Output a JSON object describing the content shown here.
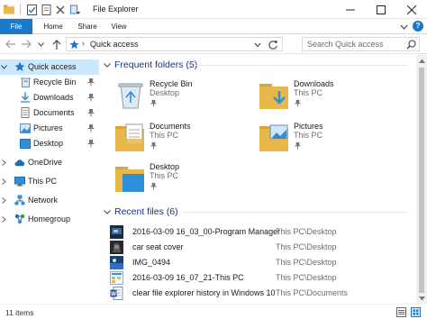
{
  "window": {
    "title": "File Explorer"
  },
  "ribbon": {
    "tabs": [
      "File",
      "Home",
      "Share",
      "View"
    ]
  },
  "address": {
    "current": "Quick access",
    "search_placeholder": "Search Quick access"
  },
  "nav": {
    "items": [
      {
        "label": "Quick access",
        "icon": "star-icon",
        "selected": true,
        "pinned": false
      },
      {
        "label": "Recycle Bin",
        "icon": "recycle-bin-icon",
        "pinned": true
      },
      {
        "label": "Downloads",
        "icon": "downloads-icon",
        "pinned": true
      },
      {
        "label": "Documents",
        "icon": "documents-icon",
        "pinned": true
      },
      {
        "label": "Pictures",
        "icon": "pictures-icon",
        "pinned": true
      },
      {
        "label": "Desktop",
        "icon": "desktop-icon",
        "pinned": true
      },
      {
        "label": "OneDrive",
        "icon": "onedrive-icon",
        "pinned": false
      },
      {
        "label": "This PC",
        "icon": "this-pc-icon",
        "pinned": false
      },
      {
        "label": "Network",
        "icon": "network-icon",
        "pinned": false
      },
      {
        "label": "Homegroup",
        "icon": "homegroup-icon",
        "pinned": false
      }
    ]
  },
  "frequent": {
    "title": "Frequent folders (5)",
    "folders": [
      {
        "name": "Recycle Bin",
        "location": "Desktop",
        "icon": "recycle-bin-icon"
      },
      {
        "name": "Downloads",
        "location": "This PC",
        "icon": "downloads-folder-icon"
      },
      {
        "name": "Documents",
        "location": "This PC",
        "icon": "documents-folder-icon"
      },
      {
        "name": "Pictures",
        "location": "This PC",
        "icon": "pictures-folder-icon"
      },
      {
        "name": "Desktop",
        "location": "This PC",
        "icon": "desktop-folder-icon"
      }
    ]
  },
  "recent": {
    "title": "Recent files (6)",
    "files": [
      {
        "name": "2016-03-09 16_03_00-Program Manager",
        "path": "This PC\\Desktop",
        "icon": "image-thumb-icon"
      },
      {
        "name": "car seat cover",
        "path": "This PC\\Desktop",
        "icon": "image-thumb-icon"
      },
      {
        "name": "IMG_0494",
        "path": "This PC\\Desktop",
        "icon": "image-thumb-icon"
      },
      {
        "name": "2016-03-09 16_07_21-This PC",
        "path": "This PC\\Desktop",
        "icon": "image-thumb-icon"
      },
      {
        "name": "clear file explorer history in Windows 10",
        "path": "This PC\\Documents",
        "icon": "word-document-icon"
      }
    ]
  },
  "status": {
    "count": "11 items"
  },
  "colors": {
    "accent": "#1979ca",
    "group_title": "#1e3287",
    "selection": "#cce8ff",
    "folder": "#e8b84a"
  }
}
